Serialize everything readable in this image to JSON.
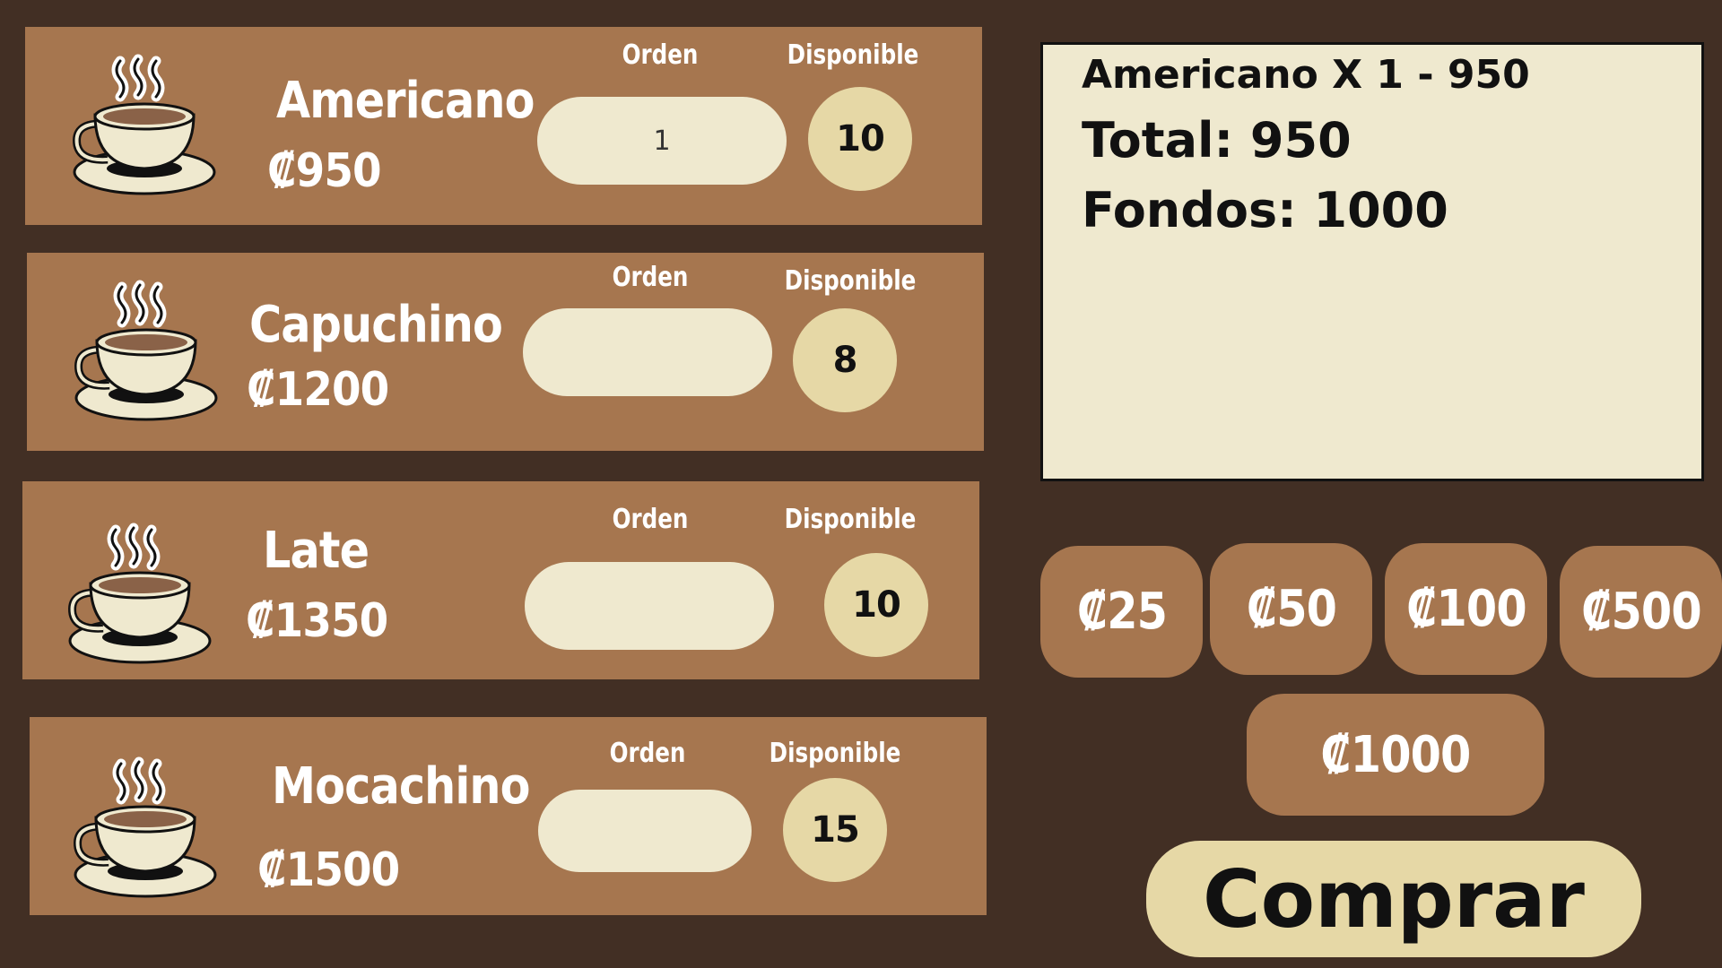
{
  "products": [
    {
      "name": "Americano",
      "price": "₡950",
      "order_label": "Orden",
      "stock_label": "Disponible",
      "order_value": "1",
      "stock": "10"
    },
    {
      "name": "Capuchino",
      "price": "₡1200",
      "order_label": "Orden",
      "stock_label": "Disponible",
      "order_value": "",
      "stock": "8"
    },
    {
      "name": "Late",
      "price": "₡1350",
      "order_label": "Orden",
      "stock_label": "Disponible",
      "order_value": "",
      "stock": "10"
    },
    {
      "name": "Mocachino",
      "price": "₡1500",
      "order_label": "Orden",
      "stock_label": "Disponible",
      "order_value": "",
      "stock": "15"
    }
  ],
  "summary": {
    "line_item": "Americano X 1 - 950",
    "total": "Total: 950",
    "funds": "Fondos: 1000"
  },
  "coins": [
    "₡25",
    "₡50",
    "₡100",
    "₡500",
    "₡1000"
  ],
  "buy_label": "Comprar",
  "icons": {
    "cup": "coffee-cup-icon"
  },
  "colors": {
    "background": "#422f24",
    "card": "#a6764f",
    "cream": "#efe9cf",
    "stock": "#e6d8a6"
  }
}
